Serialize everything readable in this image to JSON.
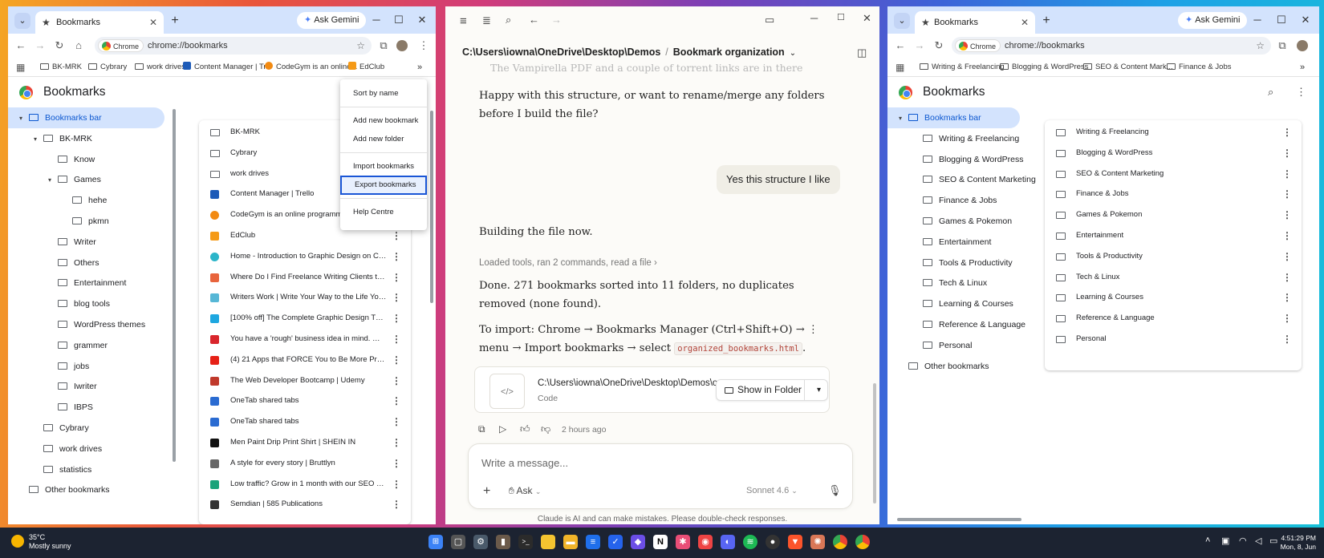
{
  "left_window": {
    "tab_title": "Bookmarks",
    "ask_gemini": "Ask Gemini",
    "omnibox_chip": "Chrome",
    "url": "chrome://bookmarks",
    "bookmarks_bar": [
      "BK-MRK",
      "Cybrary",
      "work drives",
      "Content Manager | Tr...",
      "CodeGym is an online...",
      "EdClub"
    ],
    "page_title": "Bookmarks",
    "tree": [
      {
        "label": "Bookmarks bar",
        "level": 0,
        "arrow": "▾",
        "selected": true
      },
      {
        "label": "BK-MRK",
        "level": 1,
        "arrow": "▾"
      },
      {
        "label": "Know",
        "level": 2,
        "arrow": ""
      },
      {
        "label": "Games",
        "level": 2,
        "arrow": "▾"
      },
      {
        "label": "hehe",
        "level": 3,
        "arrow": ""
      },
      {
        "label": "pkmn",
        "level": 3,
        "arrow": ""
      },
      {
        "label": "Writer",
        "level": 2,
        "arrow": ""
      },
      {
        "label": "Others",
        "level": 2,
        "arrow": ""
      },
      {
        "label": "Entertainment",
        "level": 2,
        "arrow": ""
      },
      {
        "label": "blog tools",
        "level": 2,
        "arrow": ""
      },
      {
        "label": "WordPress themes",
        "level": 2,
        "arrow": ""
      },
      {
        "label": "grammer",
        "level": 2,
        "arrow": ""
      },
      {
        "label": "jobs",
        "level": 2,
        "arrow": ""
      },
      {
        "label": "Iwriter",
        "level": 2,
        "arrow": ""
      },
      {
        "label": "IBPS",
        "level": 2,
        "arrow": ""
      },
      {
        "label": "Cybrary",
        "level": 1,
        "arrow": ""
      },
      {
        "label": "work drives",
        "level": 1,
        "arrow": ""
      },
      {
        "label": "statistics",
        "level": 1,
        "arrow": ""
      },
      {
        "label": "Other bookmarks",
        "level": 0,
        "arrow": ""
      }
    ],
    "list": [
      {
        "label": "BK-MRK",
        "icon": "folder"
      },
      {
        "label": "Cybrary",
        "icon": "folder"
      },
      {
        "label": "work drives",
        "icon": "folder"
      },
      {
        "label": "Content Manager | Trello",
        "icon": "trello",
        "color": "#1d5bb8"
      },
      {
        "label": "CodeGym is an online programming",
        "icon": "codegym",
        "color": "#f28a12"
      },
      {
        "label": "EdClub",
        "icon": "edclub",
        "color": "#f59a17"
      },
      {
        "label": "Home - Introduction to Graphic Design on Canv...",
        "icon": "canva",
        "color": "#2cb5c9"
      },
      {
        "label": "Where Do I Find Freelance Writing Clients to Col...",
        "icon": "site",
        "color": "#e8643c"
      },
      {
        "label": "Writers Work | Write Your Way to the Life You W...",
        "icon": "site",
        "color": "#57b7d6"
      },
      {
        "label": "[100% off] The Complete Graphic Design Theory ...",
        "icon": "tag",
        "color": "#1ea7e0"
      },
      {
        "label": "You have a 'rough' business idea in mind. What s...",
        "icon": "ys",
        "color": "#d9262c"
      },
      {
        "label": "(4) 21 Apps that FORCE You to Be More Producti...",
        "icon": "youtube",
        "color": "#e62117"
      },
      {
        "label": "The Web Developer Bootcamp | Udemy",
        "icon": "udemy",
        "color": "#c0392b"
      },
      {
        "label": "OneTab shared tabs",
        "icon": "onetab",
        "color": "#2a6bd1"
      },
      {
        "label": "OneTab shared tabs",
        "icon": "onetab",
        "color": "#2a6bd1"
      },
      {
        "label": "Men Paint Drip Print Shirt | SHEIN IN",
        "icon": "shein",
        "color": "#111111"
      },
      {
        "label": "A style for every story | Bruttlyn",
        "icon": "site",
        "color": "#666666"
      },
      {
        "label": "Low traffic? Grow in 1 month with our SEO Chec...",
        "icon": "site",
        "color": "#1aa37a"
      },
      {
        "label": "Semdian | 585 Publications",
        "icon": "site",
        "color": "#333333"
      }
    ],
    "menu": [
      "Sort by name",
      "Add new bookmark",
      "Add new folder",
      "Import bookmarks",
      "Export bookmarks",
      "Help Centre"
    ],
    "menu_highlight": "Export bookmarks"
  },
  "middle_window": {
    "breadcrumb_path": "C:\\Users\\iowna\\OneDrive\\Desktop\\Demos",
    "breadcrumb_sep": "/",
    "breadcrumb_current": "Bookmark organization",
    "faded_line": "The Vampirella PDF and a couple of torrent links are in there",
    "q_para": "Happy with this structure, or want to rename/merge any folders before I build the file?",
    "user_bubble": "Yes this structure I like",
    "building": "Building the file now.",
    "tools_line": "Loaded tools, ran 2 commands, read a file",
    "done_para": "Done. 271 bookmarks sorted into 11 folders, no duplicates removed (none found).",
    "import_para_a": "To import: Chrome → Bookmarks Manager (Ctrl+Shift+O) → ⋮ menu → Import bookmarks → select",
    "import_code": "organized_bookmarks.html",
    "file_name": "C:\\Users\\iowna\\OneDrive\\Desktop\\Demos\\o",
    "file_type": "Code",
    "file_icon": "</>",
    "show_in_folder": "Show in Folder",
    "timestamp": "2 hours ago",
    "composer_placeholder": "Write a message...",
    "ask": "Ask",
    "model": "Sonnet 4.6",
    "disclaimer": "Claude is AI and can make mistakes. Please double-check responses."
  },
  "right_window": {
    "tab_title": "Bookmarks",
    "ask_gemini": "Ask Gemini",
    "omnibox_chip": "Chrome",
    "url": "chrome://bookmarks",
    "bookmarks_bar": [
      "Writing & Freelancing",
      "Blogging & WordPress",
      "SEO & Content Mark...",
      "Finance & Jobs"
    ],
    "page_title": "Bookmarks",
    "tree": [
      {
        "label": "Bookmarks bar",
        "level": 0,
        "arrow": "▾",
        "selected": true
      },
      {
        "label": "Writing & Freelancing",
        "level": 1,
        "arrow": ""
      },
      {
        "label": "Blogging & WordPress",
        "level": 1,
        "arrow": ""
      },
      {
        "label": "SEO & Content Marketing",
        "level": 1,
        "arrow": ""
      },
      {
        "label": "Finance & Jobs",
        "level": 1,
        "arrow": ""
      },
      {
        "label": "Games & Pokemon",
        "level": 1,
        "arrow": ""
      },
      {
        "label": "Entertainment",
        "level": 1,
        "arrow": ""
      },
      {
        "label": "Tools & Productivity",
        "level": 1,
        "arrow": ""
      },
      {
        "label": "Tech & Linux",
        "level": 1,
        "arrow": ""
      },
      {
        "label": "Learning & Courses",
        "level": 1,
        "arrow": ""
      },
      {
        "label": "Reference & Language",
        "level": 1,
        "arrow": ""
      },
      {
        "label": "Personal",
        "level": 1,
        "arrow": ""
      },
      {
        "label": "Other bookmarks",
        "level": 0,
        "arrow": ""
      }
    ],
    "list": [
      "Writing & Freelancing",
      "Blogging & WordPress",
      "SEO & Content Marketing",
      "Finance & Jobs",
      "Games & Pokemon",
      "Entertainment",
      "Tools & Productivity",
      "Tech & Linux",
      "Learning & Courses",
      "Reference & Language",
      "Personal"
    ]
  },
  "taskbar": {
    "temp": "35°C",
    "condition": "Mostly sunny",
    "time": "4:51:29 PM",
    "date": "Mon, 8, Jun"
  }
}
